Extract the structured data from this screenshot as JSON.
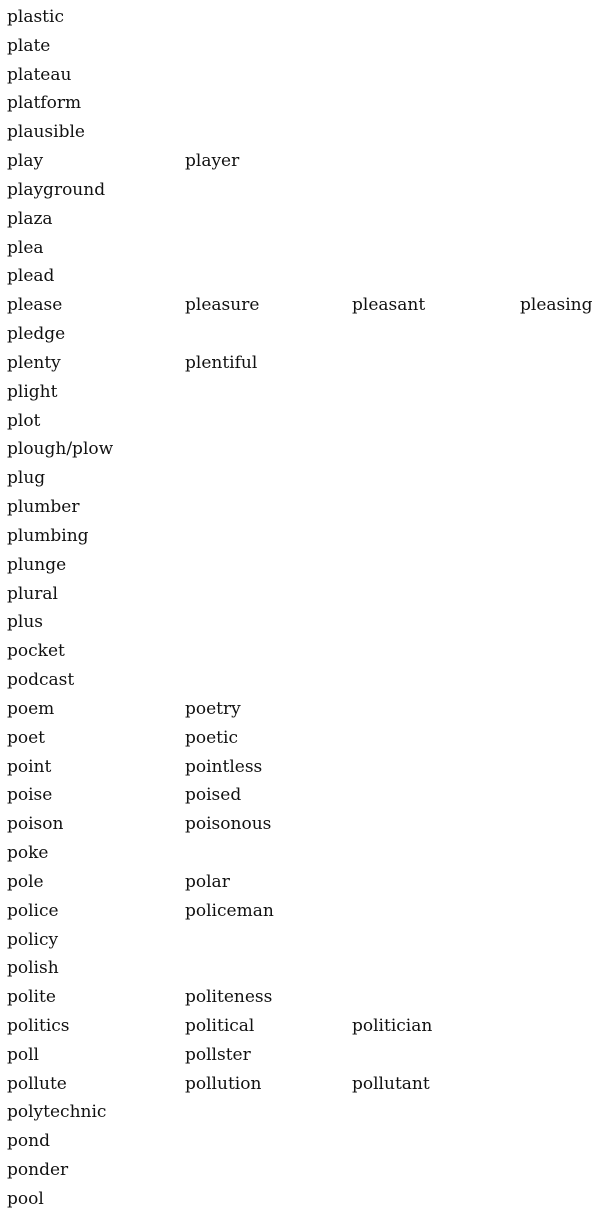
{
  "rows": [
    [
      "plastic"
    ],
    [
      "plate"
    ],
    [
      "plateau"
    ],
    [
      "platform"
    ],
    [
      "plausible"
    ],
    [
      "play",
      "player"
    ],
    [
      "playground"
    ],
    [
      "plaza"
    ],
    [
      "plea"
    ],
    [
      "plead"
    ],
    [
      "please",
      "pleasure",
      "pleasant",
      "pleasing"
    ],
    [
      "pledge"
    ],
    [
      "plenty",
      "plentiful"
    ],
    [
      "plight"
    ],
    [
      "plot"
    ],
    [
      "plough/plow"
    ],
    [
      "plug"
    ],
    [
      "plumber"
    ],
    [
      "plumbing"
    ],
    [
      "plunge"
    ],
    [
      "plural"
    ],
    [
      "plus"
    ],
    [
      "pocket"
    ],
    [
      "podcast"
    ],
    [
      "poem",
      "poetry"
    ],
    [
      "poet",
      "poetic"
    ],
    [
      "point",
      "pointless"
    ],
    [
      "poise",
      "poised"
    ],
    [
      "poison",
      "poisonous"
    ],
    [
      "poke"
    ],
    [
      "pole",
      "polar"
    ],
    [
      "police",
      "policeman"
    ],
    [
      "policy"
    ],
    [
      "polish"
    ],
    [
      "polite",
      "politeness"
    ],
    [
      "politics",
      "political",
      "politician"
    ],
    [
      "poll",
      "pollster"
    ],
    [
      "pollute",
      "pollution",
      "pollutant"
    ],
    [
      "polytechnic"
    ],
    [
      "pond"
    ],
    [
      "ponder"
    ],
    [
      "pool"
    ]
  ]
}
